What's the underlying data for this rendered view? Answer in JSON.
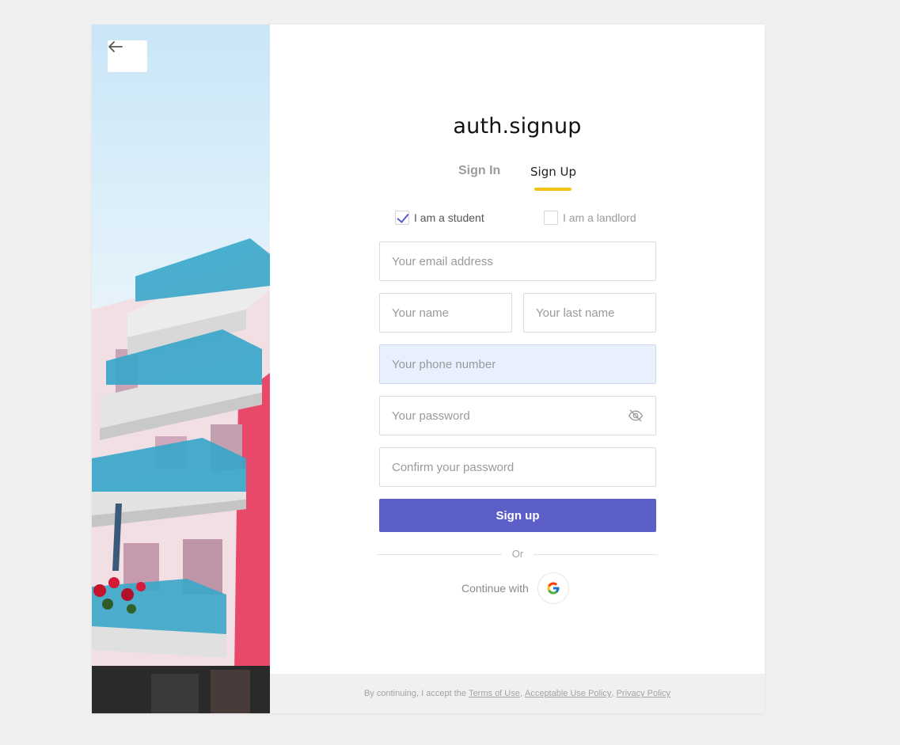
{
  "header": {
    "title": "auth.signup"
  },
  "tabs": {
    "signin_label": "Sign In",
    "signup_label": "Sign Up"
  },
  "roles": {
    "student_label": "I am a student",
    "student_checked": true,
    "landlord_label": "I am a landlord",
    "landlord_checked": false
  },
  "form": {
    "email_placeholder": "Your email address",
    "name_placeholder": "Your name",
    "last_name_placeholder": "Your last name",
    "phone_placeholder": "Your phone number",
    "password_placeholder": "Your password",
    "confirm_password_placeholder": "Confirm your password",
    "submit_label": "Sign up"
  },
  "divider_label": "Or",
  "social": {
    "continue_label": "Continue with",
    "provider_icon": "google-icon"
  },
  "footer": {
    "prefix": "By continuing, I accept the",
    "terms_label": "Terms of Use",
    "separator1": ",",
    "aup_label": "Acceptable Use Policy",
    "separator2": ",",
    "privacy_label": "Privacy Policy"
  },
  "colors": {
    "accent": "#5b5fc7",
    "tab_underline": "#f2c215",
    "phone_field_bg": "#e8f0fe",
    "page_bg": "#f0f0f0",
    "balcony_glass": "#3aa6c9",
    "building_pink": "#e8496a"
  },
  "icons": {
    "back": "arrow-left-icon",
    "password_toggle": "eye-off-icon",
    "check": "checkmark-icon"
  }
}
